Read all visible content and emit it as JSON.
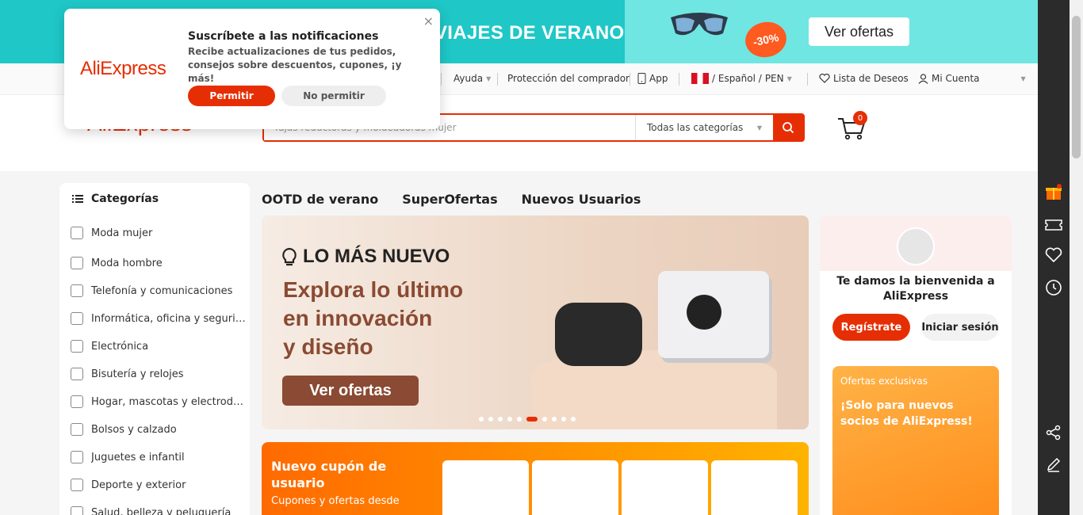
{
  "promo": {
    "title": "VIAJES DE VERANO",
    "badge": "-30%",
    "cta": "Ver ofertas"
  },
  "topnav": {
    "help": "Ayuda",
    "buyer_protection": "Protección del comprador",
    "app": "App",
    "locale": "/ Español /",
    "currency": "PEN",
    "wishlist": "Lista de Deseos",
    "account": "Mi Cuenta"
  },
  "header": {
    "logo": "AliExpress",
    "search_placeholder": "fajas reductoras y moldeadoras mujer",
    "category_select": "Todas las categorías",
    "cart_count": "0"
  },
  "notification": {
    "logo": "AliExpress",
    "title": "Suscríbete a las notificaciones",
    "description": "Recibe actualizaciones de tus pedidos, consejos sobre descuentos, cupones, ¡y más!",
    "allow": "Permitir",
    "deny": "No permitir",
    "close": "×"
  },
  "categories": {
    "heading": "Categorías",
    "items": [
      {
        "label": "Moda mujer",
        "icon": "dress-icon"
      },
      {
        "label": "Moda hombre",
        "icon": "shirt-icon"
      },
      {
        "label": "Telefonía y comunicaciones",
        "icon": "phone-icon"
      },
      {
        "label": "Informática, oficina y seguridad",
        "icon": "laptop-icon"
      },
      {
        "label": "Electrónica",
        "icon": "camera-icon"
      },
      {
        "label": "Bisutería y relojes",
        "icon": "ring-icon"
      },
      {
        "label": "Hogar, mascotas y electrodomésticos",
        "icon": "sofa-icon"
      },
      {
        "label": "Bolsos y calzado",
        "icon": "bag-icon"
      },
      {
        "label": "Juguetes e infantil",
        "icon": "bottle-icon"
      },
      {
        "label": "Deporte y exterior",
        "icon": "ball-icon"
      },
      {
        "label": "Salud, belleza y peluquería",
        "icon": "beauty-icon"
      }
    ]
  },
  "tabs": [
    "OOTD de verano",
    "SuperOfertas",
    "Nuevos Usuarios"
  ],
  "hero": {
    "tag": "LO MÁS NUEVO",
    "line1": "Explora lo último",
    "line2": "en innovación",
    "line3": "y diseño",
    "cta": "Ver ofertas",
    "slide_count": 10,
    "active_slide": 6
  },
  "coupon": {
    "title": "Nuevo cupón de usuario",
    "subtitle": "Cupones y ofertas desde"
  },
  "welcome": {
    "title": "Te damos la bienvenida a AliExpress",
    "register": "Regístrate",
    "login": "Iniciar sesión",
    "offer_tag": "Ofertas exclusivas",
    "offer_title": "¡Solo para nuevos socios de AliExpress!"
  },
  "colors": {
    "brand": "#e62e04",
    "promo_teal": "#1fc7c7",
    "sidebar_dark": "#2b2b2b"
  }
}
